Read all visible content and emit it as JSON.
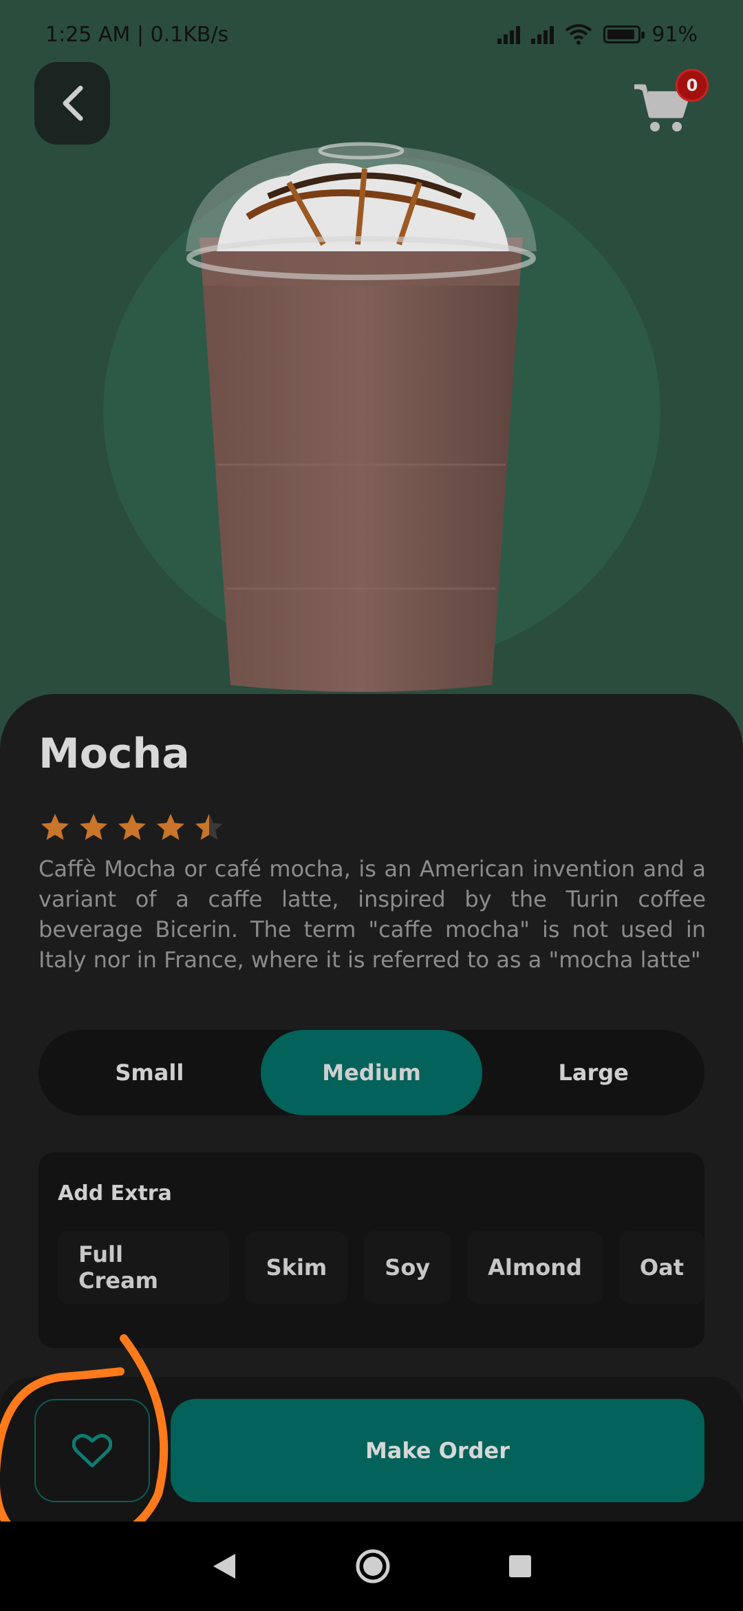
{
  "status_bar": {
    "time_speed": "1:25 AM | 0.1KB/s",
    "battery": "91%"
  },
  "cart": {
    "count": "0"
  },
  "product": {
    "name": "Mocha",
    "rating": 4.5,
    "rating_max": 5,
    "description": "Caffè Mocha or café mocha, is an American invention and a variant of a caffe latte, inspired by the Turin coffee beverage Bicerin. The term \"caffe mocha\" is not used in Italy nor in France, where it is referred to as a \"mocha latte\""
  },
  "sizes": {
    "options": [
      "Small",
      "Medium",
      "Large"
    ],
    "selected": "Medium"
  },
  "extras": {
    "title": "Add Extra",
    "options": [
      "Full Cream",
      "Skim",
      "Soy",
      "Almond",
      "Oat"
    ]
  },
  "actions": {
    "make_order": "Make Order"
  },
  "colors": {
    "background": "#2a4d3e",
    "accent": "#03625a",
    "star": "#c9752a",
    "badge": "#a31010",
    "annotation": "#ff7a1a"
  },
  "icons": [
    "back-arrow-icon",
    "cart-icon",
    "heart-icon",
    "star-icon",
    "nav-back-icon",
    "nav-home-icon",
    "nav-recents-icon"
  ]
}
